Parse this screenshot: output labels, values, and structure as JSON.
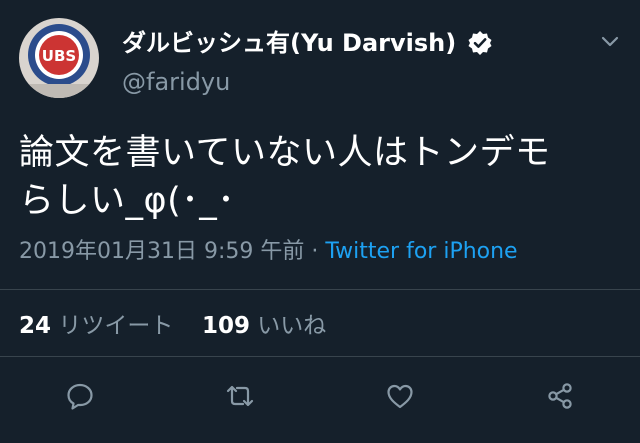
{
  "user": {
    "display_name": "ダルビッシュ有(Yu Darvish)",
    "handle": "@faridyu",
    "verified": true,
    "avatar_text": "UBS"
  },
  "tweet": {
    "line1": "論文を書いていない人はトンデモ",
    "line2": "らしい_φ(･_･",
    "timestamp": "2019年01月31日 9:59 午前",
    "separator": " · ",
    "source": "Twitter for iPhone"
  },
  "stats": {
    "retweets_count": "24",
    "retweets_label": "リツイート",
    "likes_count": "109",
    "likes_label": "いいね"
  },
  "icons": {
    "more": "chevron-down-icon",
    "reply": "reply-icon",
    "retweet": "retweet-icon",
    "like": "heart-icon",
    "share": "share-icon"
  },
  "colors": {
    "background": "#15202b",
    "secondary_text": "#8899a6",
    "accent": "#1da1f2",
    "divider": "#38444d"
  }
}
